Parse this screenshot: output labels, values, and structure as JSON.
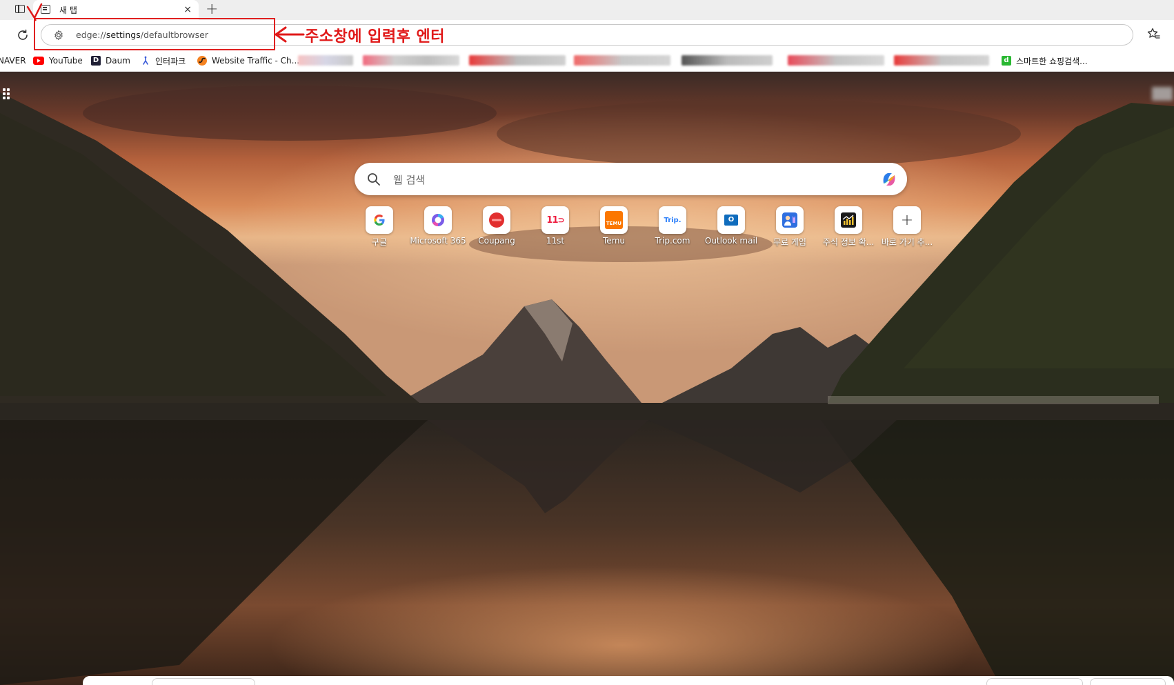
{
  "tab": {
    "title": "새 탭",
    "close_glyph": "×",
    "new_tab_glyph": "+"
  },
  "toolbar": {
    "address_scheme": "edge://",
    "address_host": "settings",
    "address_path": "/defaultbrowser",
    "icons": [
      "refresh-icon",
      "gear-icon",
      "star-favorites-icon"
    ]
  },
  "bookmarks": [
    {
      "label": "NAVER",
      "icon": "naver-icon"
    },
    {
      "label": "YouTube",
      "icon": "youtube-icon",
      "color": "#ff0000"
    },
    {
      "label": "Daum",
      "icon": "daum-icon",
      "color": "#1f1f35"
    },
    {
      "label": "인터파크",
      "icon": "interpark-icon",
      "color": "#3a5bd9"
    },
    {
      "label": "Website Traffic - Ch...",
      "icon": "similarweb-icon",
      "color": "#f58220"
    },
    {
      "label": "스마트한 쇼핑검색...",
      "icon": "danawa-icon",
      "color": "#29b832"
    }
  ],
  "annotation": {
    "text": "주소창에 입력후 엔터",
    "color": "#e01818"
  },
  "search": {
    "placeholder": "웹 검색"
  },
  "quick_links": [
    {
      "label": "구글",
      "icon": "google-icon"
    },
    {
      "label": "Microsoft 365",
      "icon": "microsoft365-icon"
    },
    {
      "label": "Coupang",
      "icon": "coupang-icon"
    },
    {
      "label": "11st",
      "icon": "11st-icon",
      "glyph": "11"
    },
    {
      "label": "Temu",
      "icon": "temu-icon",
      "glyph": "TEMU"
    },
    {
      "label": "Trip.com",
      "icon": "tripcom-icon",
      "glyph": "Trip."
    },
    {
      "label": "Outlook mail",
      "icon": "outlook-icon",
      "glyph": "O"
    },
    {
      "label": "무료 게임",
      "icon": "games-icon"
    },
    {
      "label": "주식 정보 확...",
      "icon": "stocks-icon"
    },
    {
      "label": "바로 가기 추...",
      "icon": "add-shortcut-icon",
      "glyph": "+"
    }
  ]
}
